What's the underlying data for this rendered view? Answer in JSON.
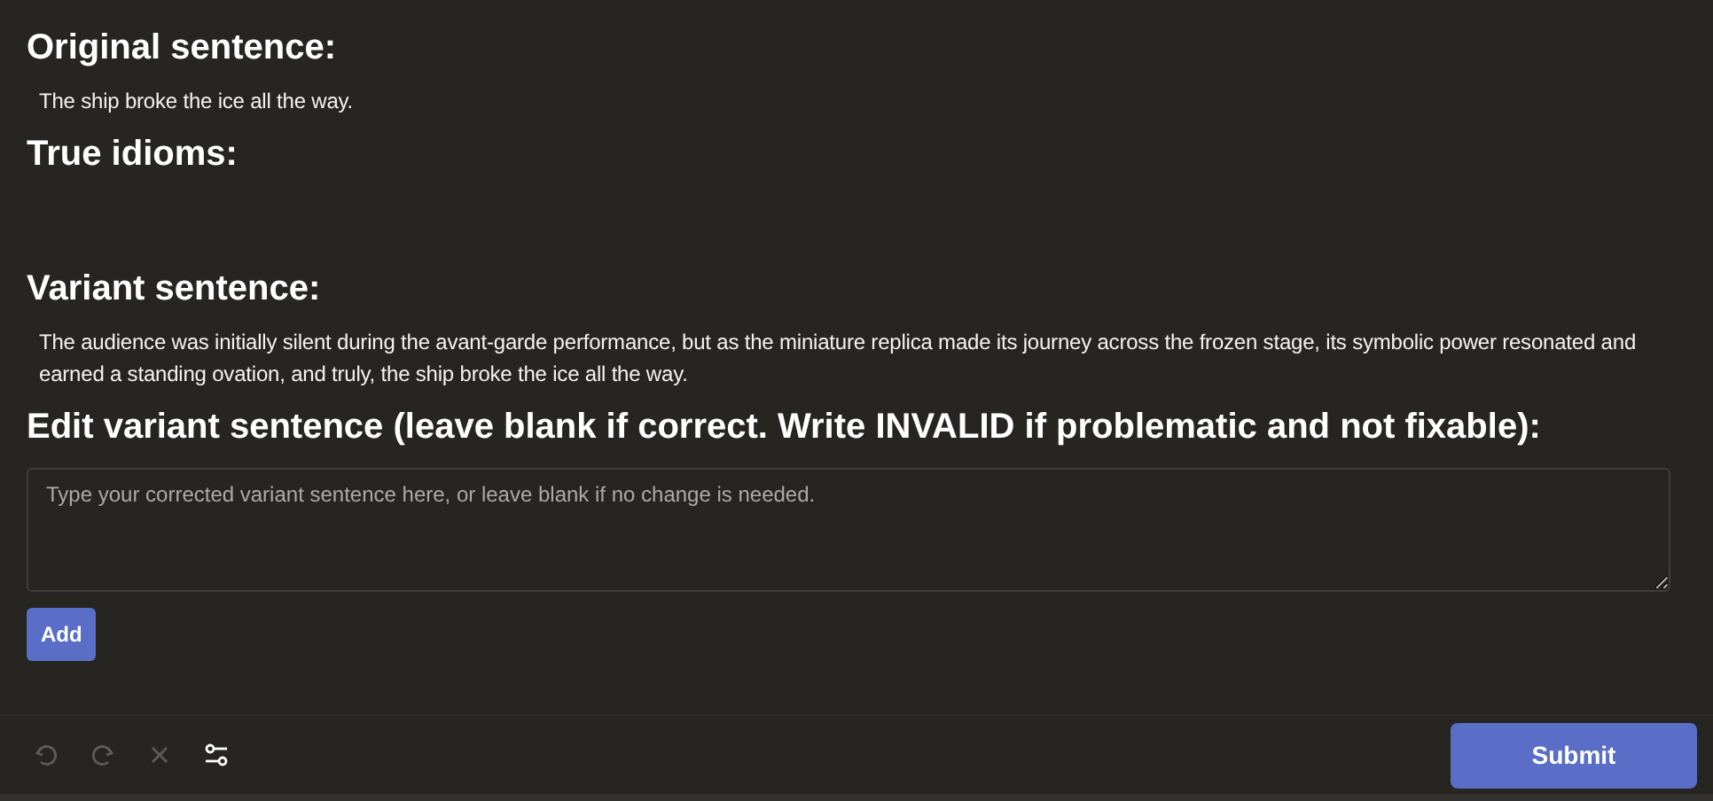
{
  "sections": [
    {
      "heading": "Original sentence:",
      "text": "The ship broke the ice all the way."
    },
    {
      "heading": "True idioms:"
    },
    {
      "heading": "Variant sentence:",
      "text": "The audience was initially silent during the avant-garde performance, but as the miniature replica made its journey across the frozen stage, its symbolic power resonated and earned a standing ovation, and truly, the ship broke the ice all the way."
    }
  ],
  "edit": {
    "heading": "Edit variant sentence (leave blank if correct. Write INVALID if problematic and not fixable):",
    "placeholder": "Type your corrected variant sentence here, or leave blank if no change is needed.",
    "add_button": "Add"
  },
  "toolbar": [
    {
      "kind": "undo",
      "disabled": true
    },
    {
      "kind": "redo",
      "disabled": true
    },
    {
      "kind": "clear",
      "disabled": true
    },
    {
      "kind": "settings",
      "disabled": false
    }
  ],
  "submit_button": "Submit"
}
